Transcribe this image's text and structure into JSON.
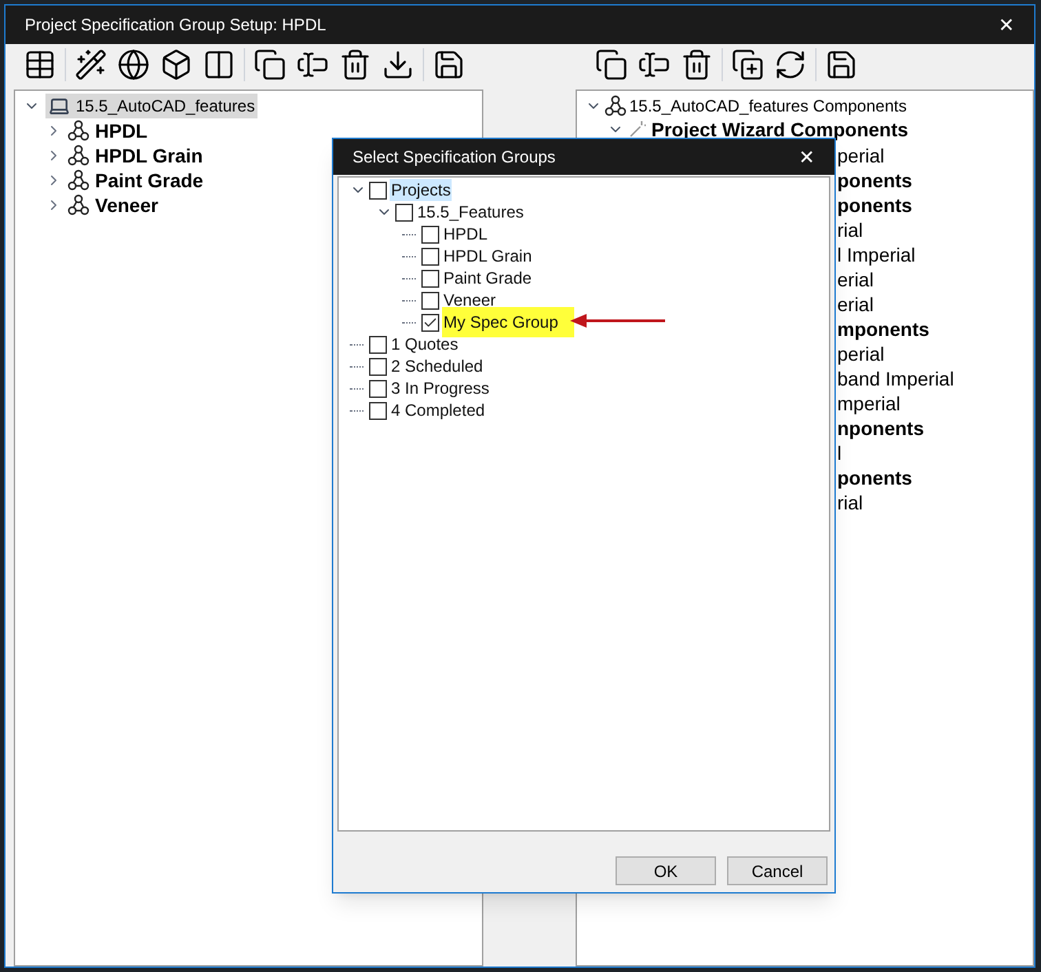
{
  "window": {
    "title": "Project Specification Group Setup: HPDL",
    "close": "✕"
  },
  "left_tree": {
    "label": "15.5_AutoCAD_features",
    "expanded": true,
    "selected": true,
    "children": [
      {
        "label": "HPDL",
        "expanded": false
      },
      {
        "label": "HPDL Grain",
        "expanded": false
      },
      {
        "label": "Paint Grade",
        "expanded": false
      },
      {
        "label": "Veneer",
        "expanded": false
      }
    ]
  },
  "right_tree": {
    "label": "15.5_AutoCAD_features Components",
    "expanded": true,
    "children": [
      {
        "label": "Project Wizard Components",
        "expanded": true
      }
    ]
  },
  "right_fragments": [
    {
      "text": "perial",
      "kind": "item"
    },
    {
      "text": "ponents",
      "kind": "group"
    },
    {
      "text": "ponents",
      "kind": "group"
    },
    {
      "text": "rial",
      "kind": "item"
    },
    {
      "text": "l Imperial",
      "kind": "item"
    },
    {
      "text": "erial",
      "kind": "item"
    },
    {
      "text": "erial",
      "kind": "item"
    },
    {
      "text": "mponents",
      "kind": "group"
    },
    {
      "text": "perial",
      "kind": "item"
    },
    {
      "text": "band Imperial",
      "kind": "item"
    },
    {
      "text": "mperial",
      "kind": "item"
    },
    {
      "text": "nponents",
      "kind": "group"
    },
    {
      "text": "l",
      "kind": "item"
    },
    {
      "text": "ponents",
      "kind": "group"
    },
    {
      "text": "rial",
      "kind": "item"
    }
  ],
  "dialog": {
    "title": "Select Specification Groups",
    "close": "✕",
    "tree": [
      {
        "label": "Projects",
        "checked": false,
        "selected": true,
        "expanded": true,
        "children": [
          {
            "label": "15.5_Features",
            "checked": false,
            "selected": false,
            "expanded": true,
            "children": [
              {
                "label": "HPDL",
                "checked": false,
                "selected": false,
                "highlighted": false
              },
              {
                "label": "HPDL Grain",
                "checked": false,
                "selected": false,
                "highlighted": false
              },
              {
                "label": "Paint Grade",
                "checked": false,
                "selected": false,
                "highlighted": false
              },
              {
                "label": "Veneer",
                "checked": false,
                "selected": false,
                "highlighted": false
              },
              {
                "label": "My Spec Group",
                "checked": true,
                "selected": false,
                "highlighted": true
              }
            ]
          }
        ]
      },
      {
        "label": "1 Quotes",
        "checked": false,
        "selected": false
      },
      {
        "label": "2 Scheduled",
        "checked": false,
        "selected": false
      },
      {
        "label": "3 In Progress",
        "checked": false,
        "selected": false
      },
      {
        "label": "4 Completed",
        "checked": false,
        "selected": false
      }
    ],
    "buttons": [
      "OK",
      "Cancel"
    ]
  }
}
